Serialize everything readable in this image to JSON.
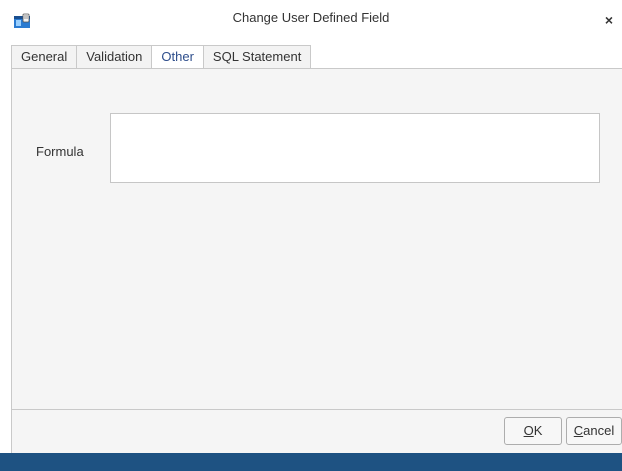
{
  "window": {
    "title": "Change User Defined Field",
    "close_glyph": "×",
    "icon": "database-window-icon"
  },
  "tabs": [
    {
      "label": "General",
      "active": false
    },
    {
      "label": "Validation",
      "active": false
    },
    {
      "label": "Other",
      "active": true
    },
    {
      "label": "SQL Statement",
      "active": false
    }
  ],
  "form": {
    "formula_label": "Formula",
    "formula_value": ""
  },
  "buttons": {
    "ok_mnemonic": "O",
    "ok_rest": "K",
    "cancel_mnemonic": "C",
    "cancel_rest": "ancel"
  },
  "colors": {
    "active_tab_text": "#2e4e8c",
    "panel_background": "#f5f5f5",
    "taskbar": "#1e5282"
  }
}
